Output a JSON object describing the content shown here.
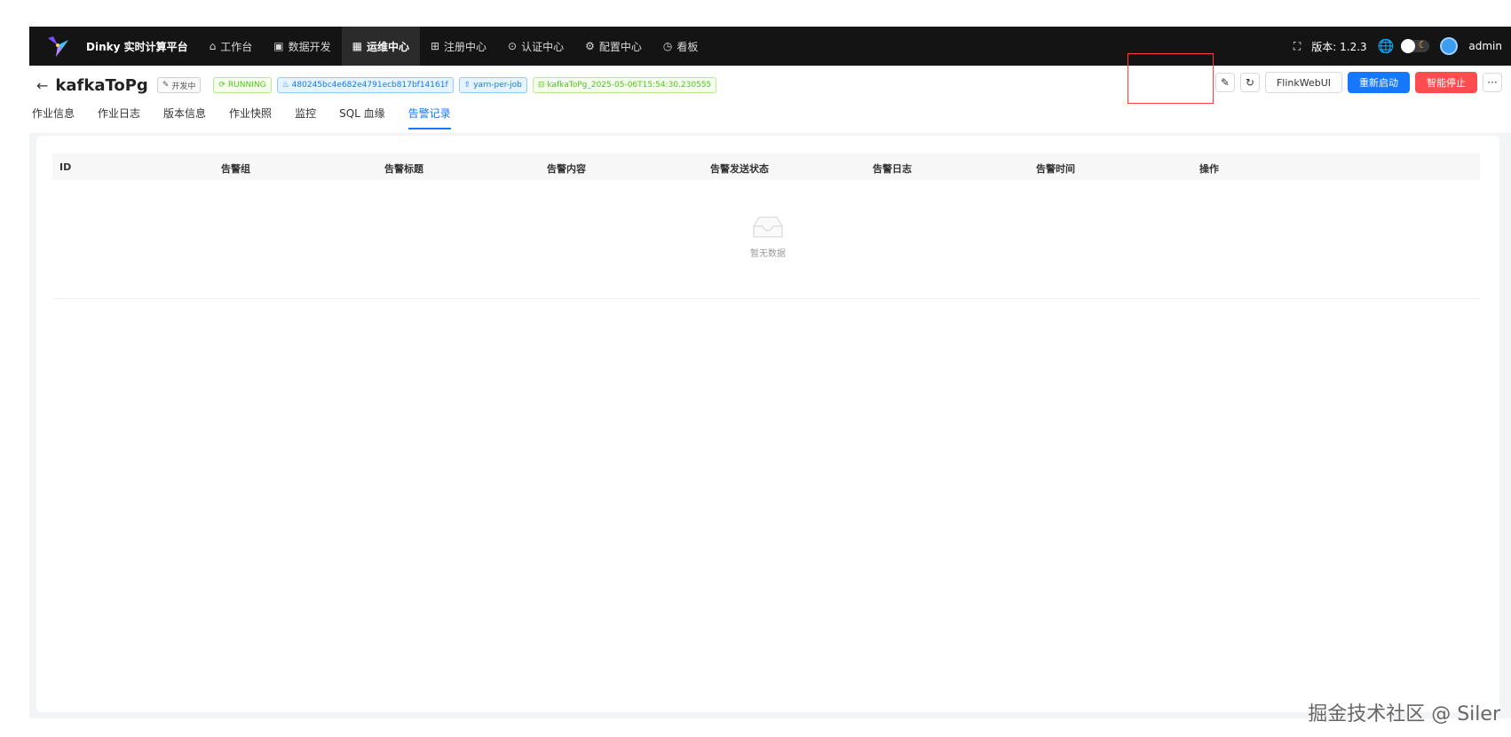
{
  "topbar": {
    "brand": "Dinky 实时计算平台",
    "nav": [
      {
        "label": "工作台",
        "icon": "home-icon",
        "glyph": "⌂"
      },
      {
        "label": "数据开发",
        "icon": "code-icon",
        "glyph": "▣"
      },
      {
        "label": "运维中心",
        "icon": "ops-icon",
        "glyph": "▦"
      },
      {
        "label": "注册中心",
        "icon": "grid-icon",
        "glyph": "⊞"
      },
      {
        "label": "认证中心",
        "icon": "shield-icon",
        "glyph": "⊙"
      },
      {
        "label": "配置中心",
        "icon": "gear-icon",
        "glyph": "⚙"
      },
      {
        "label": "看板",
        "icon": "dashboard-icon",
        "glyph": "◷"
      }
    ],
    "version": "版本: 1.2.3",
    "user": "admin"
  },
  "header": {
    "job_name": "kafkaToPg",
    "dev_tag": "开发中",
    "status_tag": "RUNNING",
    "job_id": "480245bc4e682e4791ecb817bf14161f",
    "mode_tag": "yarn-per-job",
    "instance_tag": "kafkaToPg_2025-05-06T15:54:30.230555",
    "buttons": {
      "flink_webui": "FlinkWebUI",
      "restart": "重新启动",
      "smart_stop": "智能停止",
      "more": "···"
    }
  },
  "tabs": [
    "作业信息",
    "作业日志",
    "版本信息",
    "作业快照",
    "监控",
    "SQL 血缘",
    "告警记录"
  ],
  "table": {
    "columns": [
      "ID",
      "告警组",
      "告警标题",
      "告警内容",
      "告警发送状态",
      "告警日志",
      "告警时间",
      "操作"
    ],
    "empty_text": "暂无数据"
  },
  "watermark": "掘金技术社区 @ Siler",
  "colors": {
    "primary": "#1677ff",
    "danger": "#ff4d4f",
    "running": "#52c41a",
    "highlight_box": "#ff4040",
    "topbar": "#141414"
  }
}
